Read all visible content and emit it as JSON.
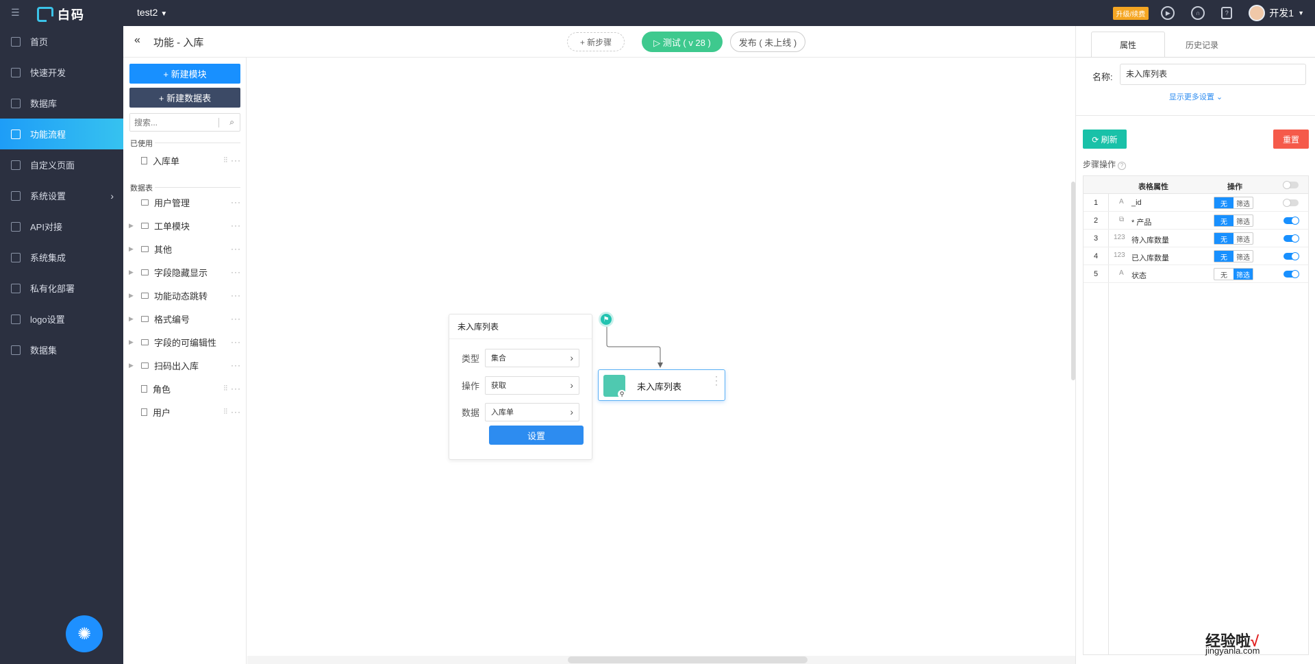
{
  "app": {
    "name": "白码",
    "project": "test2"
  },
  "topbar": {
    "upgrade_label": "升级/续费",
    "user_name": "开发1"
  },
  "sidebar": {
    "items": [
      {
        "label": "首页",
        "icon": "home-icon"
      },
      {
        "label": "快速开发",
        "icon": "cube-icon"
      },
      {
        "label": "数据库",
        "icon": "database-icon"
      },
      {
        "label": "功能流程",
        "icon": "flow-icon",
        "active": true
      },
      {
        "label": "自定义页面",
        "icon": "page-icon"
      },
      {
        "label": "系统设置",
        "icon": "chart-icon",
        "has_children": true
      },
      {
        "label": "API对接",
        "icon": "api-icon"
      },
      {
        "label": "系统集成",
        "icon": "layers-icon"
      },
      {
        "label": "私有化部署",
        "icon": "server-icon"
      },
      {
        "label": "logo设置",
        "icon": "logo-icon"
      },
      {
        "label": "数据集",
        "icon": "dataset-icon"
      }
    ]
  },
  "header": {
    "back_glyph": "«",
    "title": "功能 - 入库",
    "new_step_label": "+ 新步骤",
    "test_label": "▷ 测试 ( v 28 )",
    "publish_label": "发布 ( 未上线 )"
  },
  "leftpanel": {
    "new_module_label": "+ 新建模块",
    "new_table_label": "+ 新建数据表",
    "search_placeholder": "搜索...",
    "used_section": "已使用",
    "used_items": [
      {
        "label": "入库单",
        "type": "doc",
        "tune": true
      }
    ],
    "tables_section": "数据表",
    "tables": [
      {
        "label": "用户管理",
        "type": "folder",
        "expandable": false
      },
      {
        "label": "工单模块",
        "type": "folder",
        "expandable": true
      },
      {
        "label": "其他",
        "type": "folder",
        "expandable": true
      },
      {
        "label": "字段隐藏显示",
        "type": "folder",
        "expandable": true
      },
      {
        "label": "功能动态跳转",
        "type": "folder",
        "expandable": true
      },
      {
        "label": "格式编号",
        "type": "folder",
        "expandable": true
      },
      {
        "label": "字段的可编辑性",
        "type": "folder",
        "expandable": true
      },
      {
        "label": "扫码出入库",
        "type": "folder",
        "expandable": true
      },
      {
        "label": "角色",
        "type": "doc",
        "tune": true
      },
      {
        "label": "用户",
        "type": "doc",
        "tune": true
      }
    ]
  },
  "canvas": {
    "card": {
      "title": "未入库列表",
      "rows": [
        {
          "label": "类型",
          "value": "集合"
        },
        {
          "label": "操作",
          "value": "获取"
        },
        {
          "label": "数据",
          "value": "入库单"
        }
      ],
      "button_label": "设置"
    },
    "node": {
      "name": "未入库列表"
    }
  },
  "rightpanel": {
    "tabs": [
      "属性",
      "历史记录"
    ],
    "active_tab": 0,
    "name_label": "名称:",
    "name_value": "未入库列表",
    "more_settings": "显示更多设置 ⌄",
    "refresh_label": "⟳ 刷新",
    "reset_label": "重置",
    "steps_label": "步骤操作",
    "table_headers": {
      "attr": "表格属性",
      "op": "操作"
    },
    "seg_none": "无",
    "seg_filter": "筛选",
    "rows": [
      {
        "idx": "1",
        "type_icon": "A",
        "name": "_id",
        "op": "none",
        "visible": false
      },
      {
        "idx": "2",
        "type_icon": "⧉",
        "name": "* 产品",
        "op": "none",
        "visible": true
      },
      {
        "idx": "3",
        "type_icon": "123",
        "name": "待入库数量",
        "op": "none",
        "visible": true
      },
      {
        "idx": "4",
        "type_icon": "123",
        "name": "已入库数量",
        "op": "none",
        "visible": true
      },
      {
        "idx": "5",
        "type_icon": "A",
        "name": "状态",
        "op": "filter",
        "visible": true
      }
    ],
    "header_toggle": false
  },
  "watermark": {
    "main": "经验啦",
    "check": "√",
    "sub": "jingyanla.com"
  },
  "colors": {
    "sidebar_bg": "#2b3040",
    "accent": "#1890ff",
    "test_green": "#3ec98e",
    "refresh_teal": "#19c1a8",
    "reset_red": "#f55a4a"
  }
}
